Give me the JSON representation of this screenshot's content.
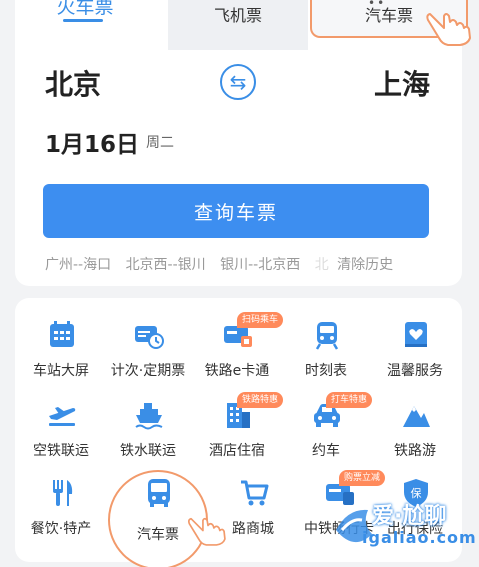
{
  "tabs": {
    "train": "火车票",
    "flight": "飞机票",
    "bus": "汽车票"
  },
  "trip": {
    "from": "北京",
    "to": "上海",
    "date": "1月16日",
    "weekday": "周二"
  },
  "query_button": "查询车票",
  "history": {
    "items": [
      "广州--海口",
      "北京西--银川",
      "银川--北京西"
    ],
    "clear_label": "清除历史"
  },
  "services": [
    {
      "label": "车站大屏",
      "icon": "station-screen-icon",
      "badge": ""
    },
    {
      "label": "计次·定期票",
      "icon": "ticket-clock-icon",
      "badge": ""
    },
    {
      "label": "铁路e卡通",
      "icon": "e-card-icon",
      "badge": "扫码乘车"
    },
    {
      "label": "时刻表",
      "icon": "train-timetable-icon",
      "badge": ""
    },
    {
      "label": "温馨服务",
      "icon": "heart-service-icon",
      "badge": ""
    },
    {
      "label": "空铁联运",
      "icon": "plane-rail-icon",
      "badge": ""
    },
    {
      "label": "铁水联运",
      "icon": "ship-rail-icon",
      "badge": ""
    },
    {
      "label": "酒店住宿",
      "icon": "hotel-icon",
      "badge": "铁路特惠"
    },
    {
      "label": "约车",
      "icon": "car-icon",
      "badge": "打车特惠"
    },
    {
      "label": "铁路游",
      "icon": "mountain-icon",
      "badge": ""
    },
    {
      "label": "餐饮·特产",
      "icon": "cutlery-icon",
      "badge": ""
    },
    {
      "label": "汽车票",
      "icon": "bus-icon",
      "badge": ""
    },
    {
      "label": "路商城",
      "icon": "cart-icon",
      "badge": ""
    },
    {
      "label": "中铁畅行卡",
      "icon": "card-icon",
      "badge": "购票立减"
    },
    {
      "label": "出行保险",
      "icon": "shield-icon",
      "badge": ""
    }
  ],
  "watermark": {
    "name": "爱·尬聊",
    "domain": "igaliao.com"
  },
  "colors": {
    "accent": "#3a8ee6",
    "button": "#3d8ef0",
    "badge": "#ff8a5b",
    "highlight": "#f29a6b"
  }
}
